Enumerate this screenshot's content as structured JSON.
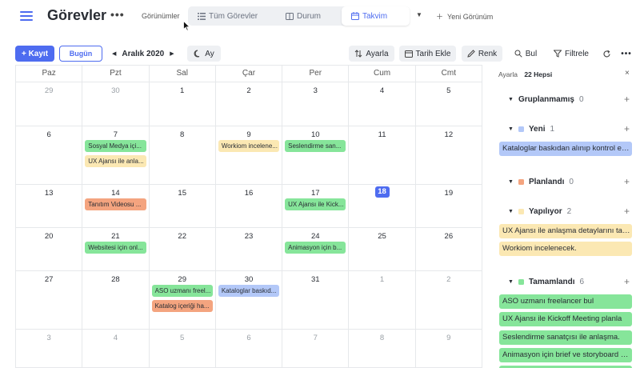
{
  "header": {
    "title": "Görevler",
    "more": "•••",
    "views_label": "Görünümler",
    "tabs": [
      {
        "label": "Tüm Görevler",
        "icon": "list-icon"
      },
      {
        "label": "Durum",
        "icon": "board-icon"
      },
      {
        "label": "Takvim",
        "icon": "calendar-icon",
        "active": true
      }
    ],
    "new_view": "Yeni Görünüm"
  },
  "toolbar": {
    "add_record": "Kayıt",
    "today": "Bugün",
    "month": "Aralık 2020",
    "view_mode": "Ay",
    "settings": "Ayarla",
    "add_date": "Tarih Ekle",
    "color": "Renk",
    "find": "Bul",
    "filter": "Filtrele"
  },
  "calendar": {
    "weekdays": [
      "Paz",
      "Pzt",
      "Sal",
      "Çar",
      "Per",
      "Cum",
      "Cmt"
    ],
    "weeks": [
      {
        "days": [
          {
            "n": "29",
            "other": true
          },
          {
            "n": "30",
            "other": true
          },
          {
            "n": "1"
          },
          {
            "n": "2"
          },
          {
            "n": "3"
          },
          {
            "n": "4"
          },
          {
            "n": "5"
          }
        ]
      },
      {
        "days": [
          {
            "n": "6"
          },
          {
            "n": "7",
            "events": [
              {
                "text": "Sosyal Medya içi...",
                "color": "green"
              },
              {
                "text": "UX Ajansı ile anla...",
                "color": "yellow"
              }
            ]
          },
          {
            "n": "8"
          },
          {
            "n": "9",
            "events": [
              {
                "text": "Workiom incelene...",
                "color": "yellow"
              }
            ]
          },
          {
            "n": "10",
            "events": [
              {
                "text": "Seslendirme san...",
                "color": "green"
              }
            ]
          },
          {
            "n": "11"
          },
          {
            "n": "12"
          }
        ]
      },
      {
        "days": [
          {
            "n": "13"
          },
          {
            "n": "14",
            "events": [
              {
                "text": "Tanıtım Videosu ...",
                "color": "orange"
              }
            ]
          },
          {
            "n": "15"
          },
          {
            "n": "16"
          },
          {
            "n": "17",
            "events": [
              {
                "text": "UX Ajansı ile Kick...",
                "color": "green"
              }
            ]
          },
          {
            "n": "18",
            "today": true
          },
          {
            "n": "19"
          }
        ]
      },
      {
        "days": [
          {
            "n": "20"
          },
          {
            "n": "21",
            "events": [
              {
                "text": "Websitesi için onl...",
                "color": "green"
              }
            ]
          },
          {
            "n": "22"
          },
          {
            "n": "23"
          },
          {
            "n": "24",
            "events": [
              {
                "text": "Animasyon için b...",
                "color": "green"
              }
            ]
          },
          {
            "n": "25"
          },
          {
            "n": "26"
          }
        ]
      },
      {
        "days": [
          {
            "n": "27"
          },
          {
            "n": "28"
          },
          {
            "n": "29",
            "events": [
              {
                "text": "ASO uzmanı freel...",
                "color": "green"
              },
              {
                "text": "Katalog içeriği ha...",
                "color": "orange"
              }
            ]
          },
          {
            "n": "30",
            "events": [
              {
                "text": "Kataloglar baskıd...",
                "color": "blue"
              }
            ]
          },
          {
            "n": "31"
          },
          {
            "n": "1",
            "other": true
          },
          {
            "n": "2",
            "other": true
          }
        ]
      },
      {
        "days": [
          {
            "n": "3",
            "other": true
          },
          {
            "n": "4",
            "other": true
          },
          {
            "n": "5",
            "other": true
          },
          {
            "n": "6",
            "other": true
          },
          {
            "n": "7",
            "other": true
          },
          {
            "n": "8",
            "other": true
          },
          {
            "n": "9",
            "other": true
          }
        ]
      }
    ]
  },
  "panel": {
    "label": "Ayarla",
    "count": "22 Hepsi",
    "close": "×",
    "groups": [
      {
        "name": "Gruplanmamış",
        "count": "0",
        "color": "",
        "items": []
      },
      {
        "name": "Yeni",
        "count": "1",
        "color": "#b3c8f8",
        "items": [
          {
            "text": "Kataloglar baskıdan alınıp kontrol edilecek",
            "color": "blue"
          }
        ]
      },
      {
        "name": "Planlandı",
        "count": "0",
        "color": "#f4a47f",
        "items": []
      },
      {
        "name": "Yapılıyor",
        "count": "2",
        "color": "#fbe8b3",
        "items": [
          {
            "text": "UX Ajansı ile anlaşma detaylarını tamamla",
            "color": "yellow"
          },
          {
            "text": "Workiom incelenecek.",
            "color": "yellow"
          }
        ]
      },
      {
        "name": "Tamamlandı",
        "count": "6",
        "color": "#86e59a",
        "items": [
          {
            "text": "ASO uzmanı freelancer bul",
            "color": "green"
          },
          {
            "text": "UX Ajansı ile Kickoff Meeting planla",
            "color": "green"
          },
          {
            "text": "Seslendirme sanatçısı ile anlaşma.",
            "color": "green"
          },
          {
            "text": "Animasyon için brief ve storyboard hazırla",
            "color": "green"
          },
          {
            "text": "",
            "color": "green"
          }
        ]
      }
    ]
  }
}
